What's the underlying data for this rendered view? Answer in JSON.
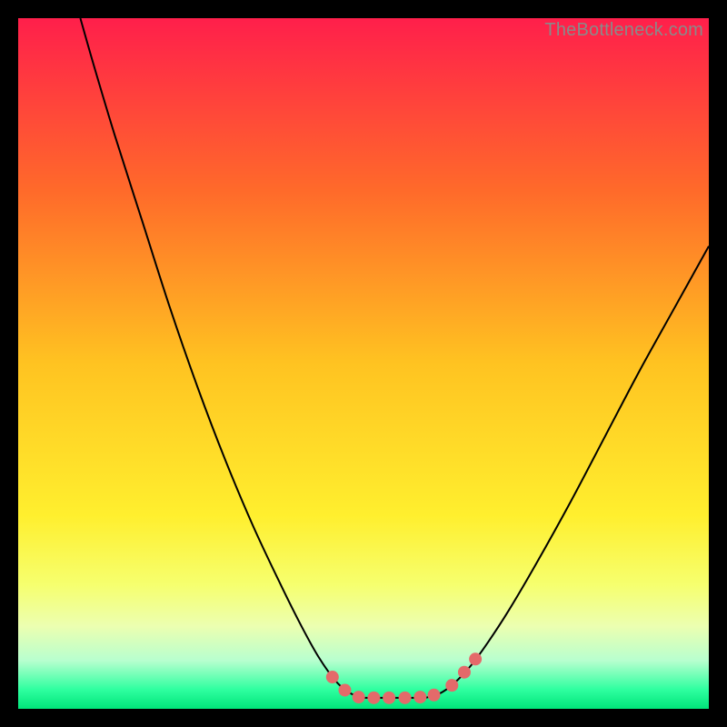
{
  "watermark": "TheBottleneck.com",
  "chart_data": {
    "type": "line",
    "title": "",
    "xlabel": "",
    "ylabel": "",
    "xlim": [
      0,
      100
    ],
    "ylim": [
      0,
      100
    ],
    "background_gradient": {
      "stops": [
        {
          "offset": 0.0,
          "color": "#ff1f4b"
        },
        {
          "offset": 0.25,
          "color": "#ff6a2a"
        },
        {
          "offset": 0.5,
          "color": "#ffc321"
        },
        {
          "offset": 0.72,
          "color": "#ffef2e"
        },
        {
          "offset": 0.82,
          "color": "#f6ff6e"
        },
        {
          "offset": 0.88,
          "color": "#ecffb0"
        },
        {
          "offset": 0.93,
          "color": "#b8ffcf"
        },
        {
          "offset": 0.972,
          "color": "#2fffa0"
        },
        {
          "offset": 1.0,
          "color": "#00e57a"
        }
      ]
    },
    "series": [
      {
        "name": "left-curve",
        "color": "#000000",
        "points": [
          {
            "x": 9.0,
            "y": 100.0
          },
          {
            "x": 11.0,
            "y": 93.0
          },
          {
            "x": 14.0,
            "y": 83.0
          },
          {
            "x": 18.0,
            "y": 70.5
          },
          {
            "x": 22.0,
            "y": 58.0
          },
          {
            "x": 26.0,
            "y": 46.5
          },
          {
            "x": 30.0,
            "y": 36.0
          },
          {
            "x": 34.0,
            "y": 26.5
          },
          {
            "x": 38.0,
            "y": 18.0
          },
          {
            "x": 41.0,
            "y": 12.0
          },
          {
            "x": 43.5,
            "y": 7.5
          },
          {
            "x": 46.0,
            "y": 4.0
          },
          {
            "x": 48.0,
            "y": 2.3
          },
          {
            "x": 50.0,
            "y": 1.6
          }
        ]
      },
      {
        "name": "right-curve",
        "color": "#000000",
        "points": [
          {
            "x": 59.0,
            "y": 1.6
          },
          {
            "x": 61.0,
            "y": 2.2
          },
          {
            "x": 63.0,
            "y": 3.6
          },
          {
            "x": 65.5,
            "y": 6.2
          },
          {
            "x": 68.0,
            "y": 9.6
          },
          {
            "x": 71.0,
            "y": 14.2
          },
          {
            "x": 75.0,
            "y": 21.0
          },
          {
            "x": 80.0,
            "y": 30.0
          },
          {
            "x": 85.0,
            "y": 39.5
          },
          {
            "x": 90.0,
            "y": 49.0
          },
          {
            "x": 95.0,
            "y": 58.0
          },
          {
            "x": 100.0,
            "y": 67.0
          }
        ]
      },
      {
        "name": "bottom-flat",
        "color": "#000000",
        "points": [
          {
            "x": 50.0,
            "y": 1.6
          },
          {
            "x": 59.0,
            "y": 1.6
          }
        ]
      }
    ],
    "markers": {
      "name": "highlight-dots",
      "color": "#e46a6a",
      "radius_px": 7,
      "points": [
        {
          "x": 45.5,
          "y": 4.6
        },
        {
          "x": 47.3,
          "y": 2.7
        },
        {
          "x": 49.3,
          "y": 1.7
        },
        {
          "x": 51.5,
          "y": 1.6
        },
        {
          "x": 53.7,
          "y": 1.6
        },
        {
          "x": 56.0,
          "y": 1.6
        },
        {
          "x": 58.2,
          "y": 1.7
        },
        {
          "x": 60.2,
          "y": 2.0
        },
        {
          "x": 62.8,
          "y": 3.4
        },
        {
          "x": 64.6,
          "y": 5.3
        },
        {
          "x": 66.2,
          "y": 7.2
        }
      ]
    }
  }
}
